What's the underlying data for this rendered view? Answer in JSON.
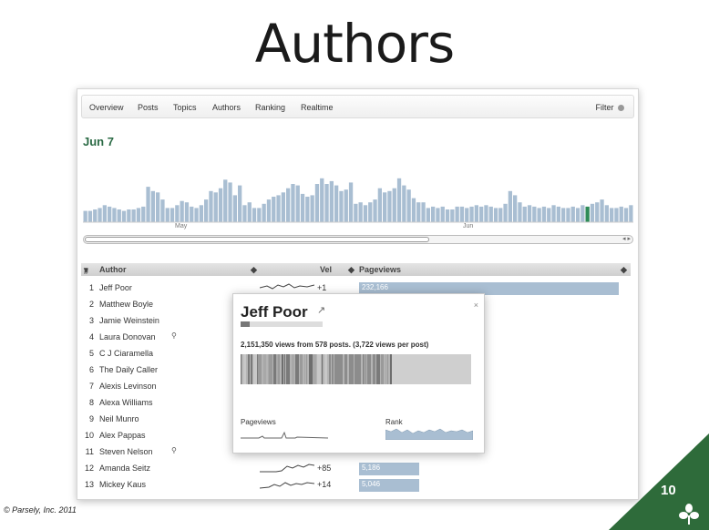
{
  "slide": {
    "title": "Authors",
    "page_number": "10",
    "copyright": "© Parsely, Inc. 2011"
  },
  "nav": {
    "tabs": [
      "Overview",
      "Posts",
      "Topics",
      "Authors",
      "Ranking",
      "Realtime"
    ],
    "filter_label": "Filter"
  },
  "date_heading": "Jun 7",
  "timeline": {
    "month_labels": [
      "May",
      "Jun"
    ],
    "values": [
      8,
      8,
      9,
      10,
      12,
      11,
      10,
      9,
      8,
      9,
      9,
      10,
      11,
      25,
      22,
      21,
      16,
      10,
      10,
      12,
      15,
      14,
      11,
      10,
      12,
      16,
      22,
      21,
      24,
      30,
      28,
      19,
      26,
      12,
      14,
      10,
      10,
      13,
      16,
      18,
      19,
      21,
      24,
      27,
      26,
      20,
      18,
      19,
      27,
      31,
      27,
      29,
      26,
      22,
      23,
      28,
      13,
      14,
      12,
      14,
      16,
      24,
      21,
      22,
      24,
      31,
      26,
      23,
      17,
      14,
      14,
      10,
      11,
      10,
      11,
      9,
      9,
      11,
      11,
      10,
      11,
      12,
      11,
      12,
      11,
      10,
      10,
      13,
      22,
      19,
      14,
      11,
      12,
      11,
      10,
      11,
      10,
      12,
      11,
      10,
      10,
      11,
      10,
      12,
      11,
      13,
      14,
      16,
      12,
      10,
      10,
      11,
      10,
      12
    ],
    "highlight_index": 104,
    "colors": {
      "bar": "#a9bed2",
      "highlight": "#2e8b57"
    }
  },
  "table": {
    "headers": {
      "rank": "#",
      "author": "Author",
      "vel": "Vel",
      "pageviews": "Pageviews"
    },
    "rows": [
      {
        "rank": "1",
        "author": "Jeff Poor",
        "vel": "+1",
        "pageviews": "232,166",
        "pv_fraction": 1.0
      },
      {
        "rank": "2",
        "author": "Matthew Boyle",
        "vel": "",
        "pageviews": "",
        "pv_fraction": 0
      },
      {
        "rank": "3",
        "author": "Jamie Weinstein",
        "vel": "",
        "pageviews": "",
        "pv_fraction": 0
      },
      {
        "rank": "4",
        "author": "Laura Donovan",
        "vel": "",
        "pageviews": "",
        "pv_fraction": 0,
        "search_icon": true
      },
      {
        "rank": "5",
        "author": "C J Ciaramella",
        "vel": "",
        "pageviews": "",
        "pv_fraction": 0
      },
      {
        "rank": "6",
        "author": "The Daily Caller",
        "vel": "",
        "pageviews": "",
        "pv_fraction": 0
      },
      {
        "rank": "7",
        "author": "Alexis Levinson",
        "vel": "",
        "pageviews": "",
        "pv_fraction": 0
      },
      {
        "rank": "8",
        "author": "Alexa Williams",
        "vel": "",
        "pageviews": "",
        "pv_fraction": 0
      },
      {
        "rank": "9",
        "author": "Neil Munro",
        "vel": "",
        "pageviews": "",
        "pv_fraction": 0
      },
      {
        "rank": "10",
        "author": "Alex Pappas",
        "vel": "",
        "pageviews": "",
        "pv_fraction": 0
      },
      {
        "rank": "11",
        "author": "Steven Nelson",
        "vel": "",
        "pageviews": "",
        "pv_fraction": 0,
        "search_icon": true
      },
      {
        "rank": "12",
        "author": "Amanda Seitz",
        "vel": "+85",
        "pageviews": "5,186",
        "pv_fraction": 0.23
      },
      {
        "rank": "13",
        "author": "Mickey Kaus",
        "vel": "+14",
        "pageviews": "5,046",
        "pv_fraction": 0.23
      }
    ]
  },
  "popup": {
    "author": "Jeff Poor",
    "stats": "2,151,350 views from 578 posts. (3,722 views per post)",
    "pageviews_label": "Pageviews",
    "rank_label": "Rank",
    "close_glyph": "×",
    "external_glyph": "↗"
  },
  "icons": {
    "search": "search-icon",
    "gear": "gear-icon",
    "external": "external-link-icon",
    "close": "close-icon",
    "leaf": "parsely-leaf-icon"
  },
  "brand_color": "#2e6b3a"
}
